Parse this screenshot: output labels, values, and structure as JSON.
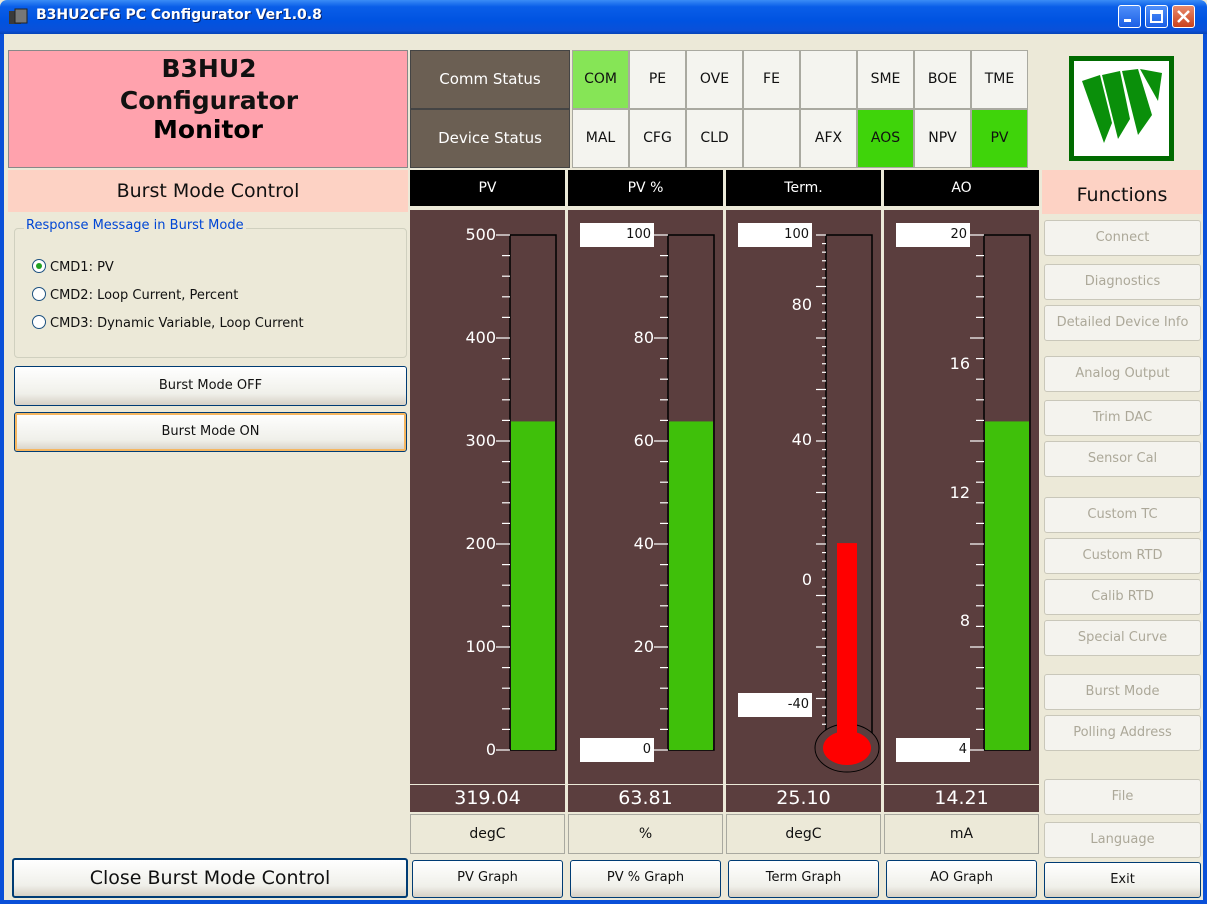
{
  "window": {
    "title": "B3HU2CFG PC Configurator Ver1.0.8"
  },
  "header": {
    "title_line1": "B3HU2",
    "title_line2": "Configurator",
    "title_line3": "Monitor"
  },
  "status": {
    "comm_label": "Comm Status",
    "device_label": "Device Status",
    "comm_cells": [
      {
        "text": "COM",
        "state": "on-light"
      },
      {
        "text": "PE",
        "state": "off"
      },
      {
        "text": "OVE",
        "state": "off"
      },
      {
        "text": "FE",
        "state": "off"
      },
      {
        "text": "",
        "state": "off"
      },
      {
        "text": "SME",
        "state": "off"
      },
      {
        "text": "BOE",
        "state": "off"
      },
      {
        "text": "TME",
        "state": "off"
      }
    ],
    "device_cells": [
      {
        "text": "MAL",
        "state": "off"
      },
      {
        "text": "CFG",
        "state": "off"
      },
      {
        "text": "CLD",
        "state": "off"
      },
      {
        "text": "",
        "state": "off"
      },
      {
        "text": "AFX",
        "state": "off"
      },
      {
        "text": "AOS",
        "state": "on"
      },
      {
        "text": "NPV",
        "state": "off"
      },
      {
        "text": "PV",
        "state": "on"
      }
    ],
    "active_color": "#3fd40a"
  },
  "burst": {
    "title": "Burst Mode Control",
    "group_label": "Response Message in Burst Mode",
    "options": [
      "CMD1: PV",
      "CMD2: Loop Current, Percent",
      "CMD3: Dynamic Variable, Loop Current"
    ],
    "selected_index": 0,
    "off_button": "Burst Mode OFF",
    "on_button": "Burst Mode ON",
    "close_button": "Close Burst Mode Control"
  },
  "gauges": [
    {
      "key": "pv",
      "header": "PV",
      "value": "319.04",
      "unit": "degC",
      "button": "PV Graph",
      "ticks": [
        "500",
        "400",
        "300",
        "200",
        "100",
        "0"
      ],
      "style": "plain",
      "fill_fraction": 0.638,
      "color": "#3fc00a"
    },
    {
      "key": "pvp",
      "header": "PV %",
      "value": "63.81",
      "unit": "%",
      "button": "PV % Graph",
      "ticks": [
        "100",
        "80",
        "60",
        "40",
        "20",
        "0"
      ],
      "style": "boxed-ends",
      "fill_fraction": 0.638,
      "color": "#3fc00a"
    },
    {
      "key": "term",
      "header": "Term.",
      "value": "25.10",
      "unit": "degC",
      "button": "Term Graph",
      "ticks": [
        "100",
        "80",
        "40",
        "0",
        "-40"
      ],
      "style": "thermo",
      "fill_fraction": 0.46,
      "color": "#ff0000"
    },
    {
      "key": "ao",
      "header": "AO",
      "value": "14.21",
      "unit": "mA",
      "button": "AO Graph",
      "ticks": [
        "20",
        "16",
        "12",
        "8",
        "4"
      ],
      "style": "boxed-ends",
      "fill_fraction": 0.638,
      "color": "#3fc00a"
    }
  ],
  "functions": {
    "title": "Functions",
    "buttons": [
      "Connect",
      "Diagnostics",
      "Detailed Device Info",
      "Analog Output",
      "Trim DAC",
      "Sensor Cal",
      "Custom TC",
      "Custom RTD",
      "Calib RTD",
      "Special Curve",
      "Burst Mode",
      "Polling Address",
      "File",
      "Language"
    ],
    "exit": "Exit"
  }
}
